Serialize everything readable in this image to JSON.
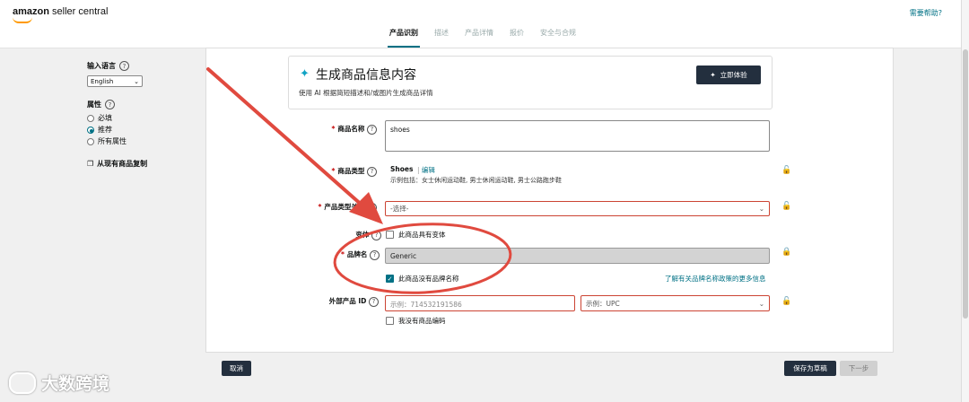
{
  "header": {
    "logo_bold": "amazon",
    "logo_rest": " seller central",
    "help": "需要帮助?"
  },
  "tabs": [
    {
      "label": "产品识别",
      "active": true
    },
    {
      "label": "描述",
      "active": false
    },
    {
      "label": "产品详情",
      "active": false
    },
    {
      "label": "报价",
      "active": false
    },
    {
      "label": "安全与合规",
      "active": false
    }
  ],
  "sidebar": {
    "language_label": "输入语言",
    "language_value": "English",
    "attributes_label": "属性",
    "options": [
      {
        "label": "必填",
        "selected": false
      },
      {
        "label": "推荐",
        "selected": true
      },
      {
        "label": "所有属性",
        "selected": false
      }
    ],
    "copy_label": "从现有商品复制"
  },
  "generate": {
    "title": "生成商品信息内容",
    "subtitle": "使用 AI 根据简短描述和/或图片生成商品详情",
    "button": "立即体验"
  },
  "form": {
    "product_name": {
      "label": "商品名称",
      "value": "shoes"
    },
    "product_type": {
      "label": "商品类型",
      "value": "Shoes",
      "edit": "编辑",
      "examples": "示例包括：女士休闲运动鞋, 男士休闲运动鞋, 男士公路跑步鞋"
    },
    "product_type_keyword": {
      "label": "产品类型关键",
      "placeholder": "-选择-"
    },
    "variation": {
      "label": "变体",
      "checkbox": "此商品具有变体",
      "checked": false
    },
    "brand": {
      "label": "品牌名",
      "value": "Generic",
      "checkbox": "此商品没有品牌名称",
      "checked": true,
      "link": "了解有关品牌名称政策的更多信息"
    },
    "external_id": {
      "label": "外部产品 ID",
      "placeholder": "示例：714532191586",
      "type_placeholder": "示例：UPC",
      "no_code": "我没有商品编码",
      "no_code_checked": false
    }
  },
  "footer": {
    "cancel": "取消",
    "save_draft": "保存为草稿",
    "next": "下一步"
  },
  "watermark": "大数跨境",
  "colors": {
    "accent": "#007185",
    "dark_button": "#232f3e",
    "annotation_red": "#e04a3f"
  }
}
